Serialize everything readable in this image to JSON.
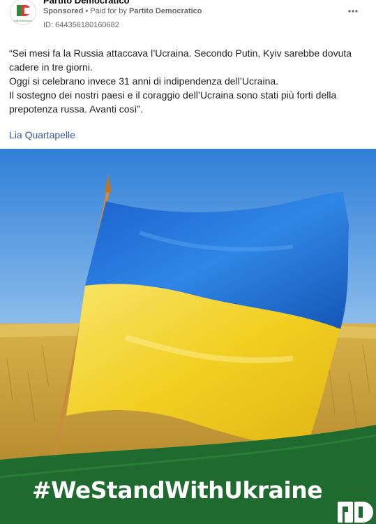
{
  "header": {
    "page_name": "Partito Democratico",
    "sponsored_label": "Sponsored",
    "separator": "•",
    "paid_for_prefix": "Paid for by",
    "paid_for_by": "Partito Democratico",
    "ad_id": "ID: 644356180160682",
    "more_icon": "more-dots-icon"
  },
  "post": {
    "lines": [
      "“Sei mesi fa la Russia attaccava l’Ucraina. Secondo Putin, Kyiv sarebbe dovuta cadere in tre giorni.",
      "Oggi si celebrano invece 31 anni di indipendenza dell’Ucraina.",
      "Il sostegno dei nostri paesi e il coraggio dell’Ucraina sono stati più forti della prepotenza russa. Avanti così”."
    ],
    "author_link": "Lia Quartapelle"
  },
  "media": {
    "hashtag": "#WeStandWithUkraine",
    "flag_colors": {
      "blue": "#1f6fd6",
      "yellow": "#f2d22a"
    },
    "field_color": "#c9a33a",
    "banner_color": "#1f6b2f",
    "logo_text": "PD"
  }
}
